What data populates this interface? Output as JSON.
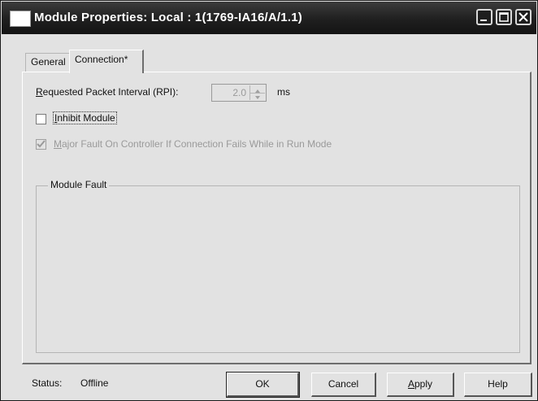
{
  "window": {
    "title": "Module Properties: Local : 1(1769-IA16/A/1.1)"
  },
  "tabs": [
    {
      "label": "General"
    },
    {
      "label": "Connection*"
    }
  ],
  "connection": {
    "rpi_label": {
      "pre": "",
      "key": "R",
      "post": "equested Packet Interval (RPI):"
    },
    "rpi_value": "2.0",
    "rpi_unit": "ms",
    "inhibit_module": {
      "pre": "",
      "key": "I",
      "post": "nhibit Module",
      "checked": false
    },
    "major_fault": {
      "pre": "",
      "key": "M",
      "post": "ajor Fault On Controller If Connection Fails While in Run Mode",
      "checked": true,
      "enabled": false
    },
    "module_fault_title": "Module Fault"
  },
  "status": {
    "label": "Status:",
    "value": "Offline"
  },
  "buttons": {
    "ok": "OK",
    "cancel": "Cancel",
    "apply": {
      "pre": "",
      "key": "A",
      "post": "pply"
    },
    "help": "Help"
  }
}
